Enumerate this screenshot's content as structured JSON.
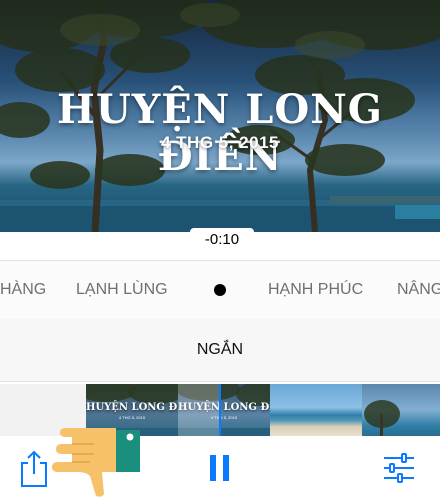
{
  "hero": {
    "title": "HUYỆN LONG ĐIỀN",
    "date": "4 THG 5, 2015"
  },
  "time_remaining": "-0:10",
  "moods": [
    "HÀNG",
    "LẠNH LÙNG",
    "HẠNH PHÚC",
    "NÂNG"
  ],
  "selected_mood_indicator": "dot",
  "length": {
    "label": "NGẮN"
  },
  "filmstrip": {
    "frames": [
      {
        "title": "HUYỆN LONG ĐIỀN",
        "date": "4 THG 5, 2015"
      },
      {
        "title": "HUYỆN LONG ĐIỀN",
        "date": "4 THG 5, 2015"
      }
    ]
  },
  "toolbar": {
    "share_icon": "share-icon",
    "pause_icon": "pause-icon",
    "settings_icon": "sliders-icon"
  },
  "colors": {
    "accent": "#0a7aff",
    "thumbs_hand": "#f7c16a",
    "thumbs_cuff": "#1a8f7e"
  }
}
